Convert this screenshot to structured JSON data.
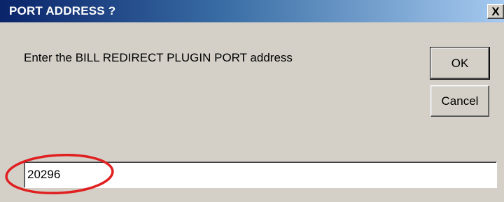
{
  "window": {
    "title": "PORT ADDRESS ?",
    "close_label": "X"
  },
  "dialog": {
    "prompt": "Enter the BILL REDIRECT PLUGIN PORT address",
    "ok_label": "OK",
    "cancel_label": "Cancel",
    "port_value": "20296"
  },
  "annotation": {
    "highlight_color": "#e02020"
  }
}
